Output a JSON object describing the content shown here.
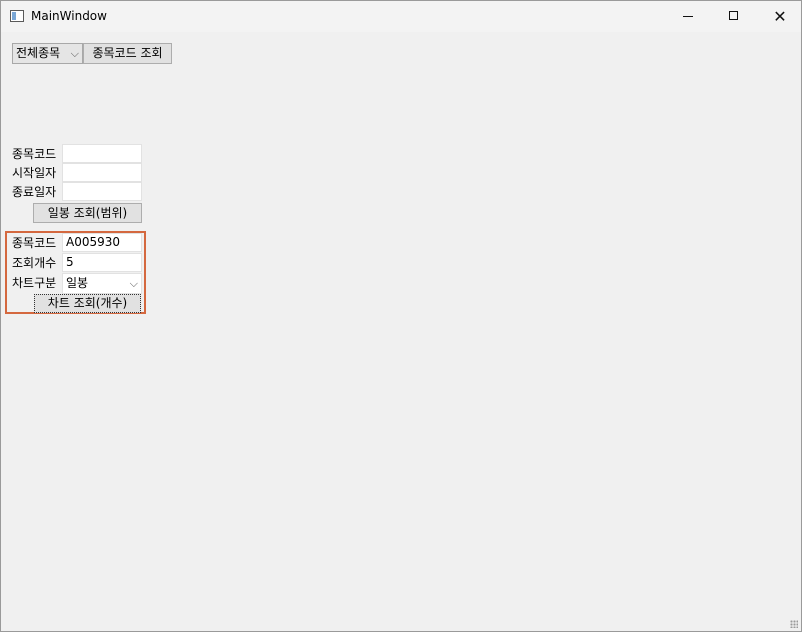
{
  "window": {
    "title": "MainWindow"
  },
  "top_bar": {
    "market_combo": "전체종목",
    "code_lookup_button": "종목코드 조회"
  },
  "range_form": {
    "code_label": "종목코드",
    "code_value": "",
    "start_label": "시작일자",
    "start_value": "",
    "end_label": "종료일자",
    "end_value": "",
    "submit_label": "일봉 조회(범위)"
  },
  "count_form": {
    "code_label": "종목코드",
    "code_value": "A005930",
    "count_label": "조회개수",
    "count_value": "5",
    "chart_type_label": "차트구분",
    "chart_type_value": "일봉",
    "submit_label": "차트 조회(개수)"
  },
  "colors": {
    "highlight": "#d4683f",
    "window_bg": "#f0f0f0"
  }
}
